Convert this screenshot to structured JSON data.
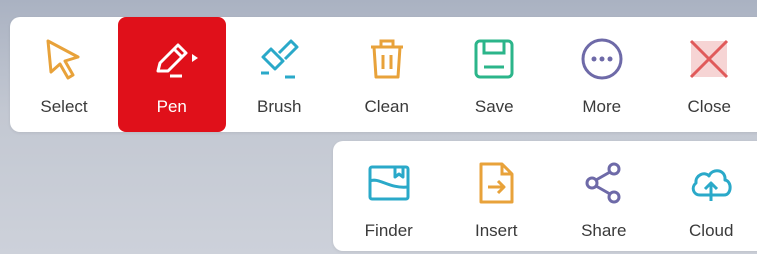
{
  "main_toolbar": {
    "items": [
      {
        "label": "Select",
        "icon": "cursor-arrow-icon"
      },
      {
        "label": "Pen",
        "icon": "pen-icon",
        "active": true
      },
      {
        "label": "Brush",
        "icon": "brush-icon"
      },
      {
        "label": "Clean",
        "icon": "trash-icon"
      },
      {
        "label": "Save",
        "icon": "save-disk-icon"
      },
      {
        "label": "More",
        "icon": "more-dots-icon"
      },
      {
        "label": "Close",
        "icon": "close-x-icon"
      }
    ]
  },
  "sub_toolbar": {
    "items": [
      {
        "label": "Finder",
        "icon": "folder-icon"
      },
      {
        "label": "Insert",
        "icon": "insert-file-icon"
      },
      {
        "label": "Share",
        "icon": "share-icon"
      },
      {
        "label": "Cloud",
        "icon": "cloud-upload-icon"
      }
    ]
  },
  "colors": {
    "active_background": "#e0101a",
    "select_icon": "#e8a23a",
    "brush_icon": "#2aa9c9",
    "clean_icon": "#e8a23a",
    "save_icon": "#2bb58a",
    "more_icon": "#6e6aa8",
    "close_icon": "#e05a5a",
    "finder_icon": "#2aa9c9",
    "insert_icon": "#e8a23a",
    "share_icon": "#6e6aa8",
    "cloud_icon": "#2aa9c9"
  }
}
